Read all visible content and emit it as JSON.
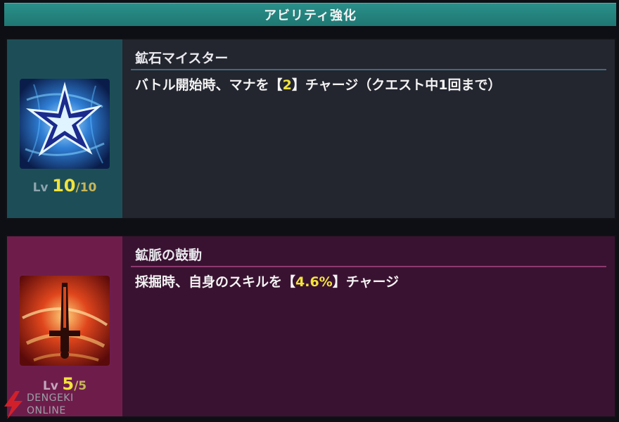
{
  "header": {
    "title": "アビリティ強化"
  },
  "abilities": [
    {
      "name": "鉱石マイスター",
      "desc_before": "バトル開始時、マナを【",
      "desc_value": "2",
      "desc_after": "】チャージ（クエスト中1回まで）",
      "level_prefix": "Lv",
      "level_current": "10",
      "level_slash": "/",
      "level_max": "10",
      "icon": "star-burst-icon"
    },
    {
      "name": "鉱脈の鼓動",
      "desc_before": "採掘時、自身のスキルを【",
      "desc_value": "4.6%",
      "desc_after": "】チャージ",
      "level_prefix": "Lv",
      "level_current": "5",
      "level_slash": "/",
      "level_max": "5",
      "icon": "sword-flame-icon"
    }
  ],
  "watermark": {
    "line1": "DENGEKI",
    "line2": "ONLINE"
  },
  "colors": {
    "header": "#1f7772",
    "card1_left": "#1d4e57",
    "card1_right": "#23252f",
    "card2_left": "#6e1d4b",
    "card2_right": "#3a1231",
    "highlight": "#f2e33c"
  }
}
